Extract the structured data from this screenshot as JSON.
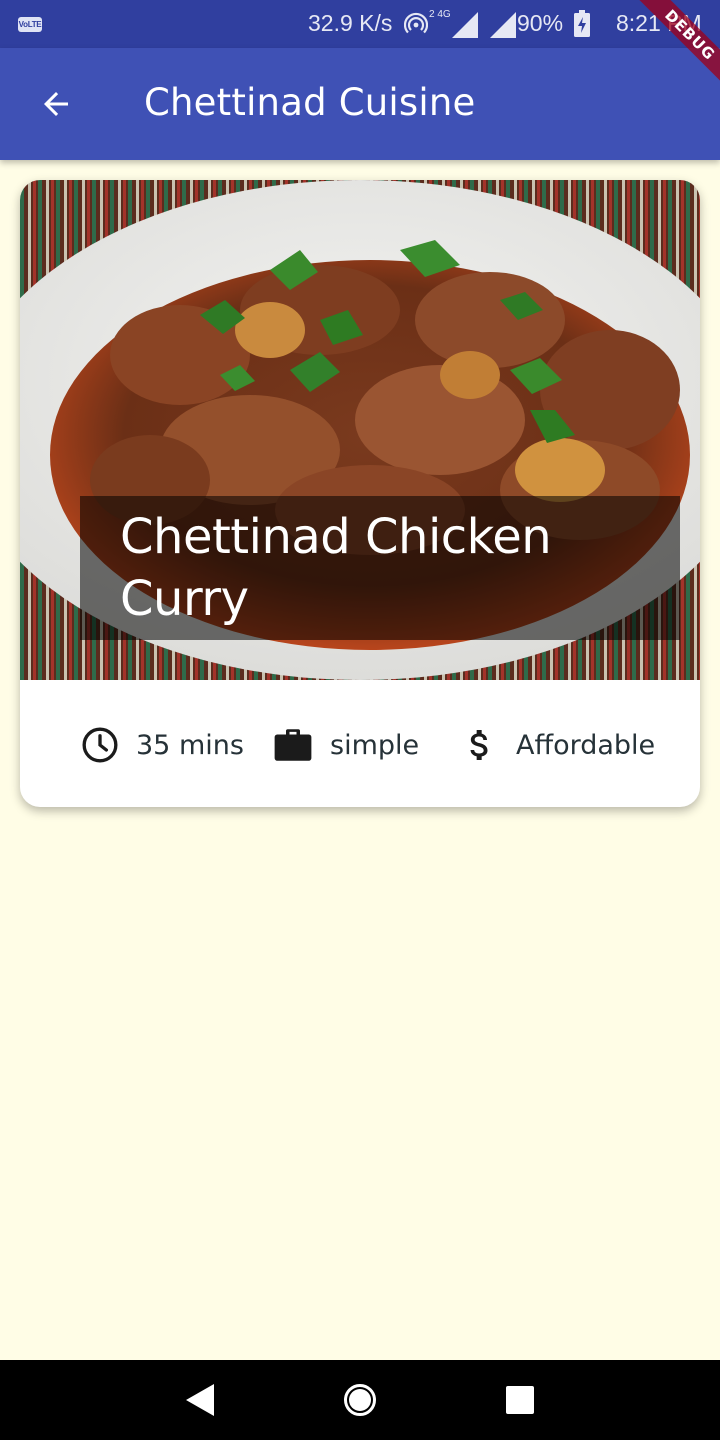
{
  "status_bar": {
    "volte": "VoLTE",
    "net_speed": "32.9 K/s",
    "network_tag": "2 4G",
    "battery": "90%",
    "time": "8:21 PM"
  },
  "app_bar": {
    "title": "Chettinad Cuisine",
    "back_icon": "arrow-back-icon"
  },
  "debug_banner": "DEBUG",
  "meal": {
    "title": "Chettinad Chicken Curry",
    "duration": "35 mins",
    "complexity": "simple",
    "affordability": "Affordable",
    "icons": {
      "duration": "schedule-icon",
      "complexity": "work-icon",
      "affordability": "attach-money-icon"
    }
  },
  "nav_bar": {
    "icons": [
      "back-triangle-icon",
      "home-circle-icon",
      "recents-square-icon"
    ]
  },
  "colors": {
    "status_bar": "#303f9f",
    "app_bar": "#3f51b5",
    "background": "#fffde6",
    "card": "#ffffff",
    "info_text": "#263238"
  }
}
